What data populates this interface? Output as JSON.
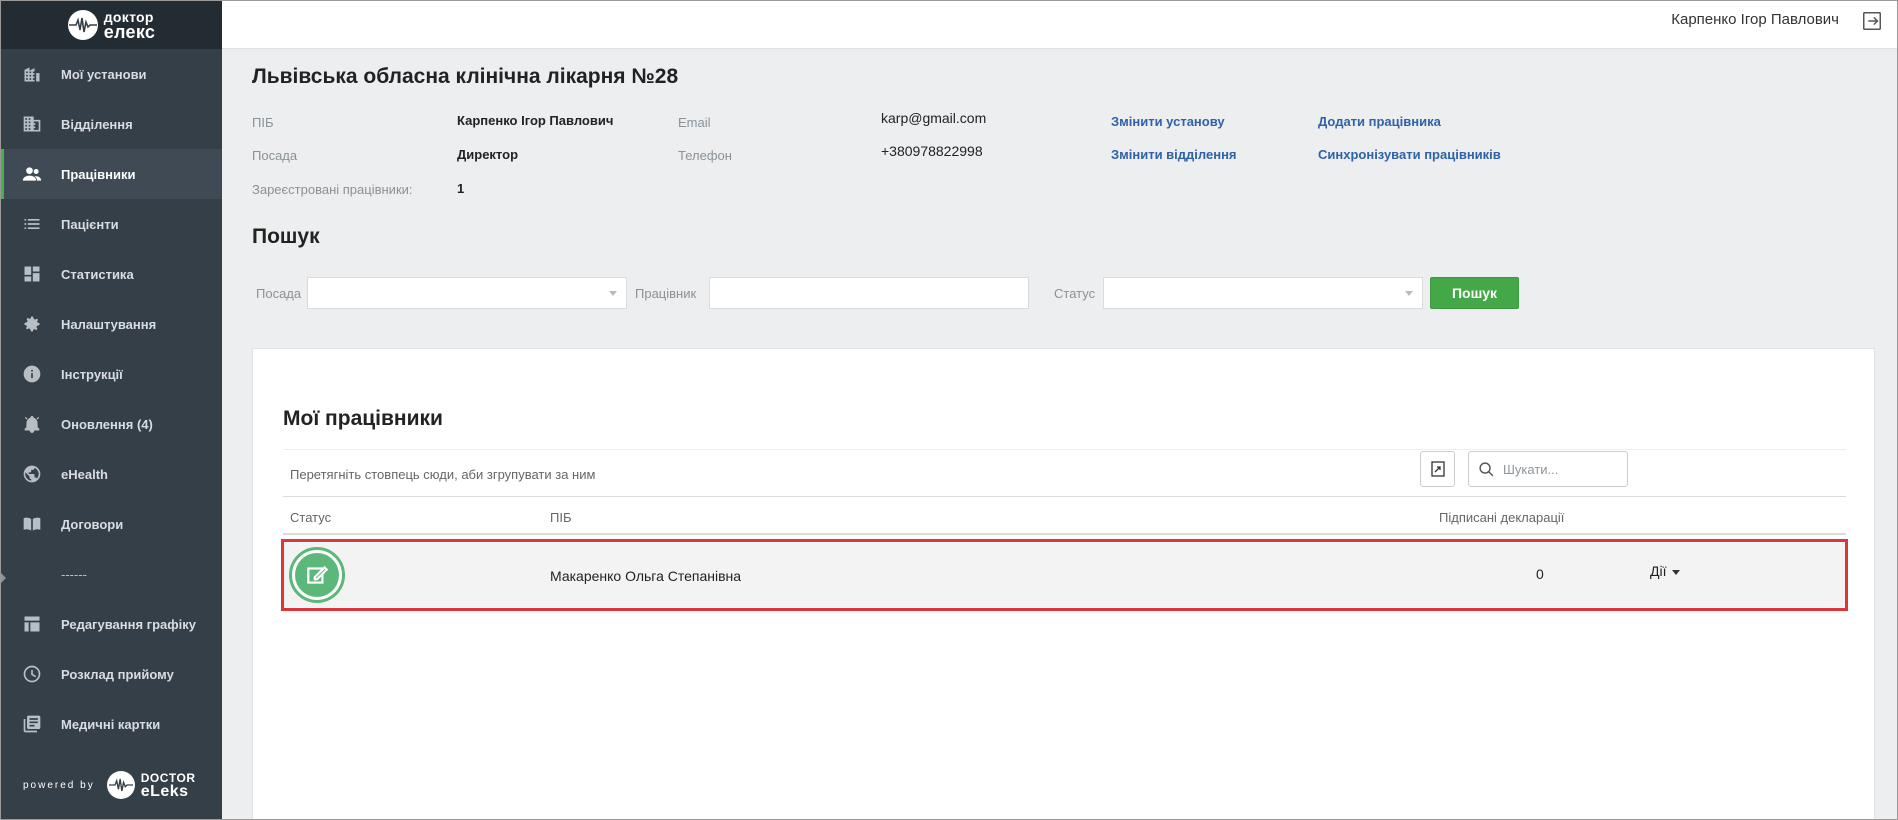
{
  "app": {
    "logo_line1": "доктор",
    "logo_line2": "елекс",
    "user_name": "Карпенко Ігор Павлович",
    "logout_icon": "logout-icon"
  },
  "sidebar": {
    "items": [
      {
        "label": "Мої установи",
        "icon": "building-icon"
      },
      {
        "label": "Відділення",
        "icon": "department-icon"
      },
      {
        "label": "Працівники",
        "icon": "people-icon",
        "active": true
      },
      {
        "label": "Пацієнти",
        "icon": "list-icon"
      },
      {
        "label": "Статистика",
        "icon": "dashboard-icon"
      },
      {
        "label": "Налаштування",
        "icon": "gear-icon"
      },
      {
        "label": "Інструкції",
        "icon": "info-icon"
      },
      {
        "label": "Оновлення (4)",
        "icon": "bell-icon"
      },
      {
        "label": "eHealth",
        "icon": "globe-icon"
      },
      {
        "label": "Договори",
        "icon": "book-icon"
      },
      {
        "label": "------",
        "icon": ""
      },
      {
        "label": "Редагування графіку",
        "icon": "table-icon"
      },
      {
        "label": "Розклад прийому",
        "icon": "clock-icon"
      },
      {
        "label": "Медичні картки",
        "icon": "cards-icon"
      }
    ],
    "powered_by": "powered by",
    "powered_logo_line1": "DOCTOR",
    "powered_logo_line2": "eLeks"
  },
  "institution": {
    "title": "Львівська обласна клінічна лікарня №28",
    "fields": {
      "pib_label": "ПІБ",
      "pib_value": "Карпенко Ігор Павлович",
      "position_label": "Посада",
      "position_value": "Директор",
      "registered_label": "Зареєстровані працівники:",
      "registered_value": "1",
      "email_label": "Email",
      "email_value": "karp@gmail.com",
      "phone_label": "Телефон",
      "phone_value": "+380978822998"
    },
    "links": {
      "change_institution": "Змінити установу",
      "change_department": "Змінити відділення",
      "add_employee": "Додати працівника",
      "sync_employees": "Синхронізувати працівників"
    }
  },
  "search": {
    "title": "Пошук",
    "position_label": "Посада",
    "employee_label": "Працівник",
    "status_label": "Статус",
    "button": "Пошук"
  },
  "employees": {
    "title": "Мої працівники",
    "group_hint": "Перетягніть стовпець сюди, аби згрупувати за ним",
    "search_placeholder": "Шукати...",
    "columns": [
      "Статус",
      "ПІБ",
      "Підписані декларації"
    ],
    "rows": [
      {
        "name": "Макаренко Ольга Степанівна",
        "declarations": "0",
        "actions": "Дії"
      }
    ]
  },
  "colors": {
    "sidebar_bg": "#353f48",
    "accent_green": "#45a848",
    "link_blue": "#2f62a8",
    "highlight_red": "#e0343b"
  }
}
